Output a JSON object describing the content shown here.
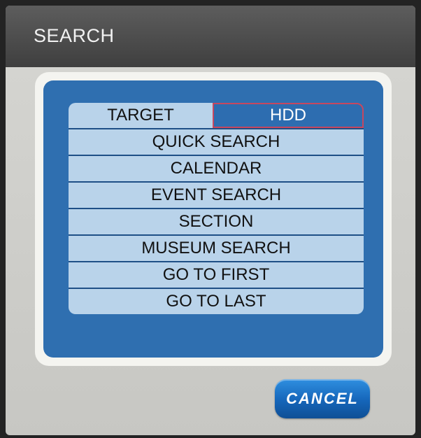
{
  "window": {
    "title": "SEARCH"
  },
  "menu": {
    "target_label": "TARGET",
    "target_value": "HDD",
    "items": [
      {
        "label": "QUICK SEARCH"
      },
      {
        "label": "CALENDAR"
      },
      {
        "label": "EVENT SEARCH"
      },
      {
        "label": "SECTION"
      },
      {
        "label": "MUSEUM SEARCH"
      },
      {
        "label": "GO TO FIRST"
      },
      {
        "label": "GO TO LAST"
      }
    ]
  },
  "actions": {
    "cancel_label": "CANCEL"
  },
  "colors": {
    "panel_blue": "#2f6fb0",
    "item_light_blue": "#b9d3ea",
    "selection_border": "#c7475f",
    "button_blue": "#1565b9"
  }
}
